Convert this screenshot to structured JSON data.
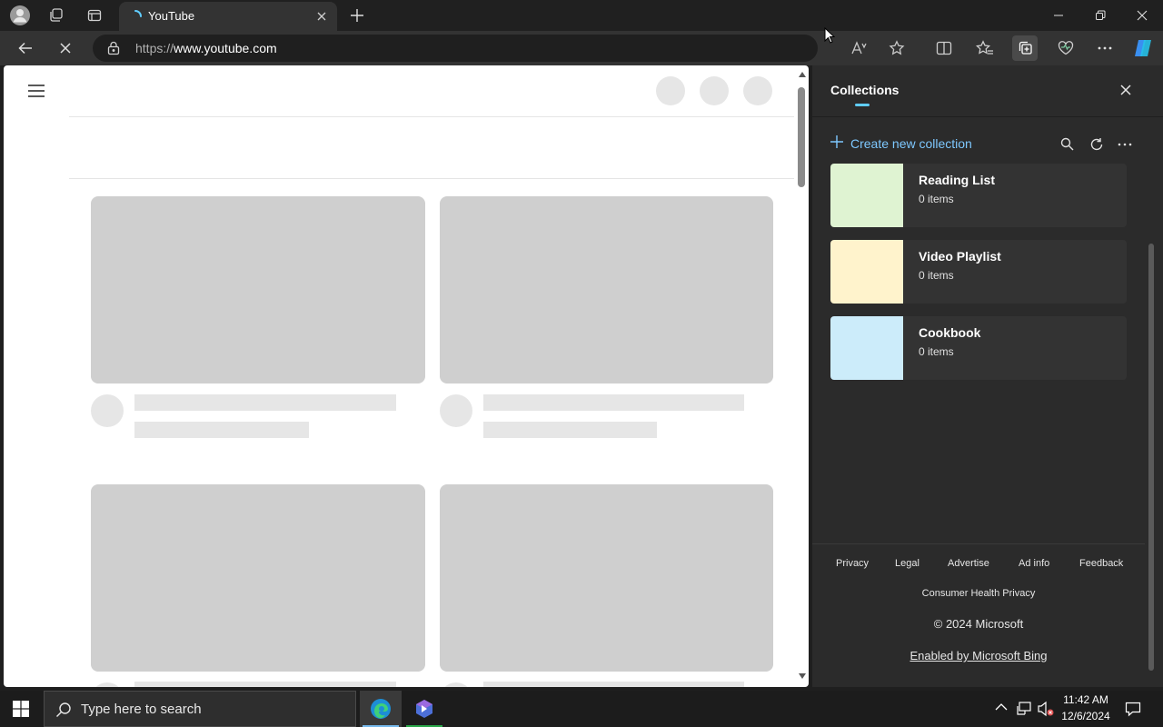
{
  "browser": {
    "tab_title": "YouTube",
    "url_prefix": "https://",
    "url_domain": "www.youtube.com"
  },
  "collections": {
    "title": "Collections",
    "create_label": "Create new collection",
    "items": [
      {
        "name": "Reading List",
        "count": "0 items",
        "color": "#dff3d2"
      },
      {
        "name": "Video Playlist",
        "count": "0 items",
        "color": "#fff3cc"
      },
      {
        "name": "Cookbook",
        "count": "0 items",
        "color": "#ccecfa"
      }
    ],
    "footer": {
      "links": [
        "Privacy",
        "Legal",
        "Advertise",
        "Ad info",
        "Feedback"
      ],
      "consumer": "Consumer Health Privacy",
      "copyright": "© 2024 Microsoft",
      "bing": "Enabled by Microsoft Bing"
    }
  },
  "taskbar": {
    "search_placeholder": "Type here to search",
    "time": "11:42 AM",
    "date": "12/6/2024"
  },
  "colors": {
    "accent": "#60cdff",
    "link": "#7ec8ff",
    "skeleton": "#cfcfcf"
  }
}
